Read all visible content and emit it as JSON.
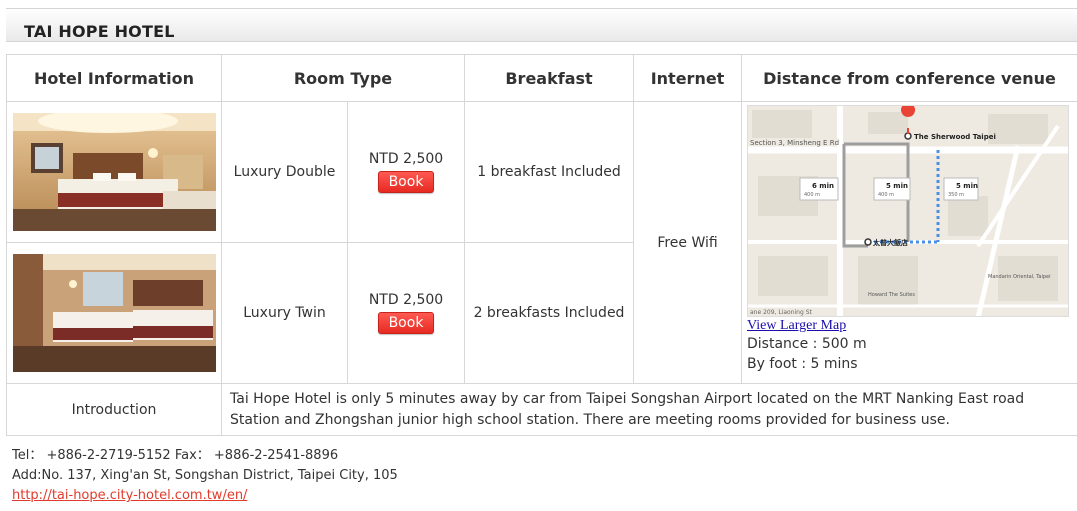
{
  "hotel_name": "TAI HOPE HOTEL",
  "headers": {
    "hotel_info": "Hotel Information",
    "room_type": "Room Type",
    "breakfast": "Breakfast",
    "internet": "Internet",
    "distance": "Distance from conference venue"
  },
  "rooms": [
    {
      "name": "Luxury Double",
      "price": "NTD 2,500",
      "book_label": "Book",
      "breakfast": "1 breakfast Included"
    },
    {
      "name": "Luxury Twin",
      "price": "NTD 2,500",
      "book_label": "Book",
      "breakfast": "2 breakfasts Included"
    }
  ],
  "internet": "Free Wifi",
  "map": {
    "view_larger_label": "View Larger Map",
    "distance_text": "Distance : 500 m",
    "walk_text": "By foot : 5 mins",
    "labels": {
      "destination": "The Sherwood Taipei",
      "origin": "太普大飯店",
      "road_minsheng": "Section 3, Minsheng E Rd",
      "walk1": "6 min",
      "walk1_dist": "400 m",
      "walk2": "5 min",
      "walk2_dist": "400 m",
      "walk3": "5 min",
      "walk3_dist": "350 m",
      "road_liaoning": "ane 209, Liaoning St",
      "mandarin": "Mandarin Oriental, Taipei",
      "howard": "Howard The Suites"
    }
  },
  "intro": {
    "label": "Introduction",
    "text": "Tai Hope Hotel is only 5 minutes away by car from Taipei Songshan Airport located on the MRT Nanking East road Station and Zhongshan junior high school station. There are meeting rooms provided for business use."
  },
  "contact": {
    "phone_line": "Tel： +886-2-2719-5152 Fax： +886-2-2541-8896",
    "address": "Add:No. 137, Xing'an St, Songshan District, Taipei City, 105",
    "url": "http://tai-hope.city-hotel.com.tw/en/"
  },
  "colors": {
    "book_button": "#e62a22",
    "link": "#1a0dab",
    "url": "#e03b2c",
    "route": "#4a90e2"
  }
}
